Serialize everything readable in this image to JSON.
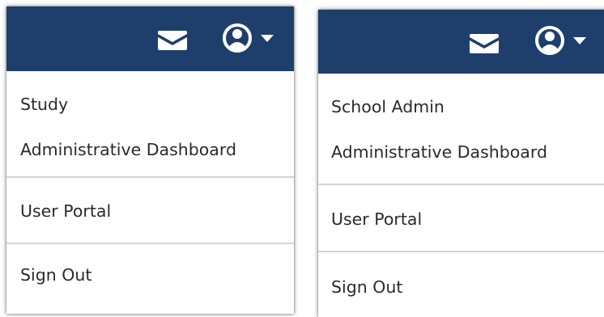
{
  "colors": {
    "navbar": "#1e3f6c",
    "icon": "#ffffff",
    "text": "#2a2a2a",
    "divider": "#d3d3d3"
  },
  "icons": {
    "mail": "envelope-icon",
    "user": "user-circle-icon",
    "caret": "caret-down-icon"
  },
  "menus": [
    {
      "items": [
        "Study",
        "Administrative Dashboard",
        "User Portal",
        "Sign Out"
      ]
    },
    {
      "items": [
        "School Admin",
        "Administrative Dashboard",
        "User Portal",
        "Sign Out"
      ]
    }
  ]
}
